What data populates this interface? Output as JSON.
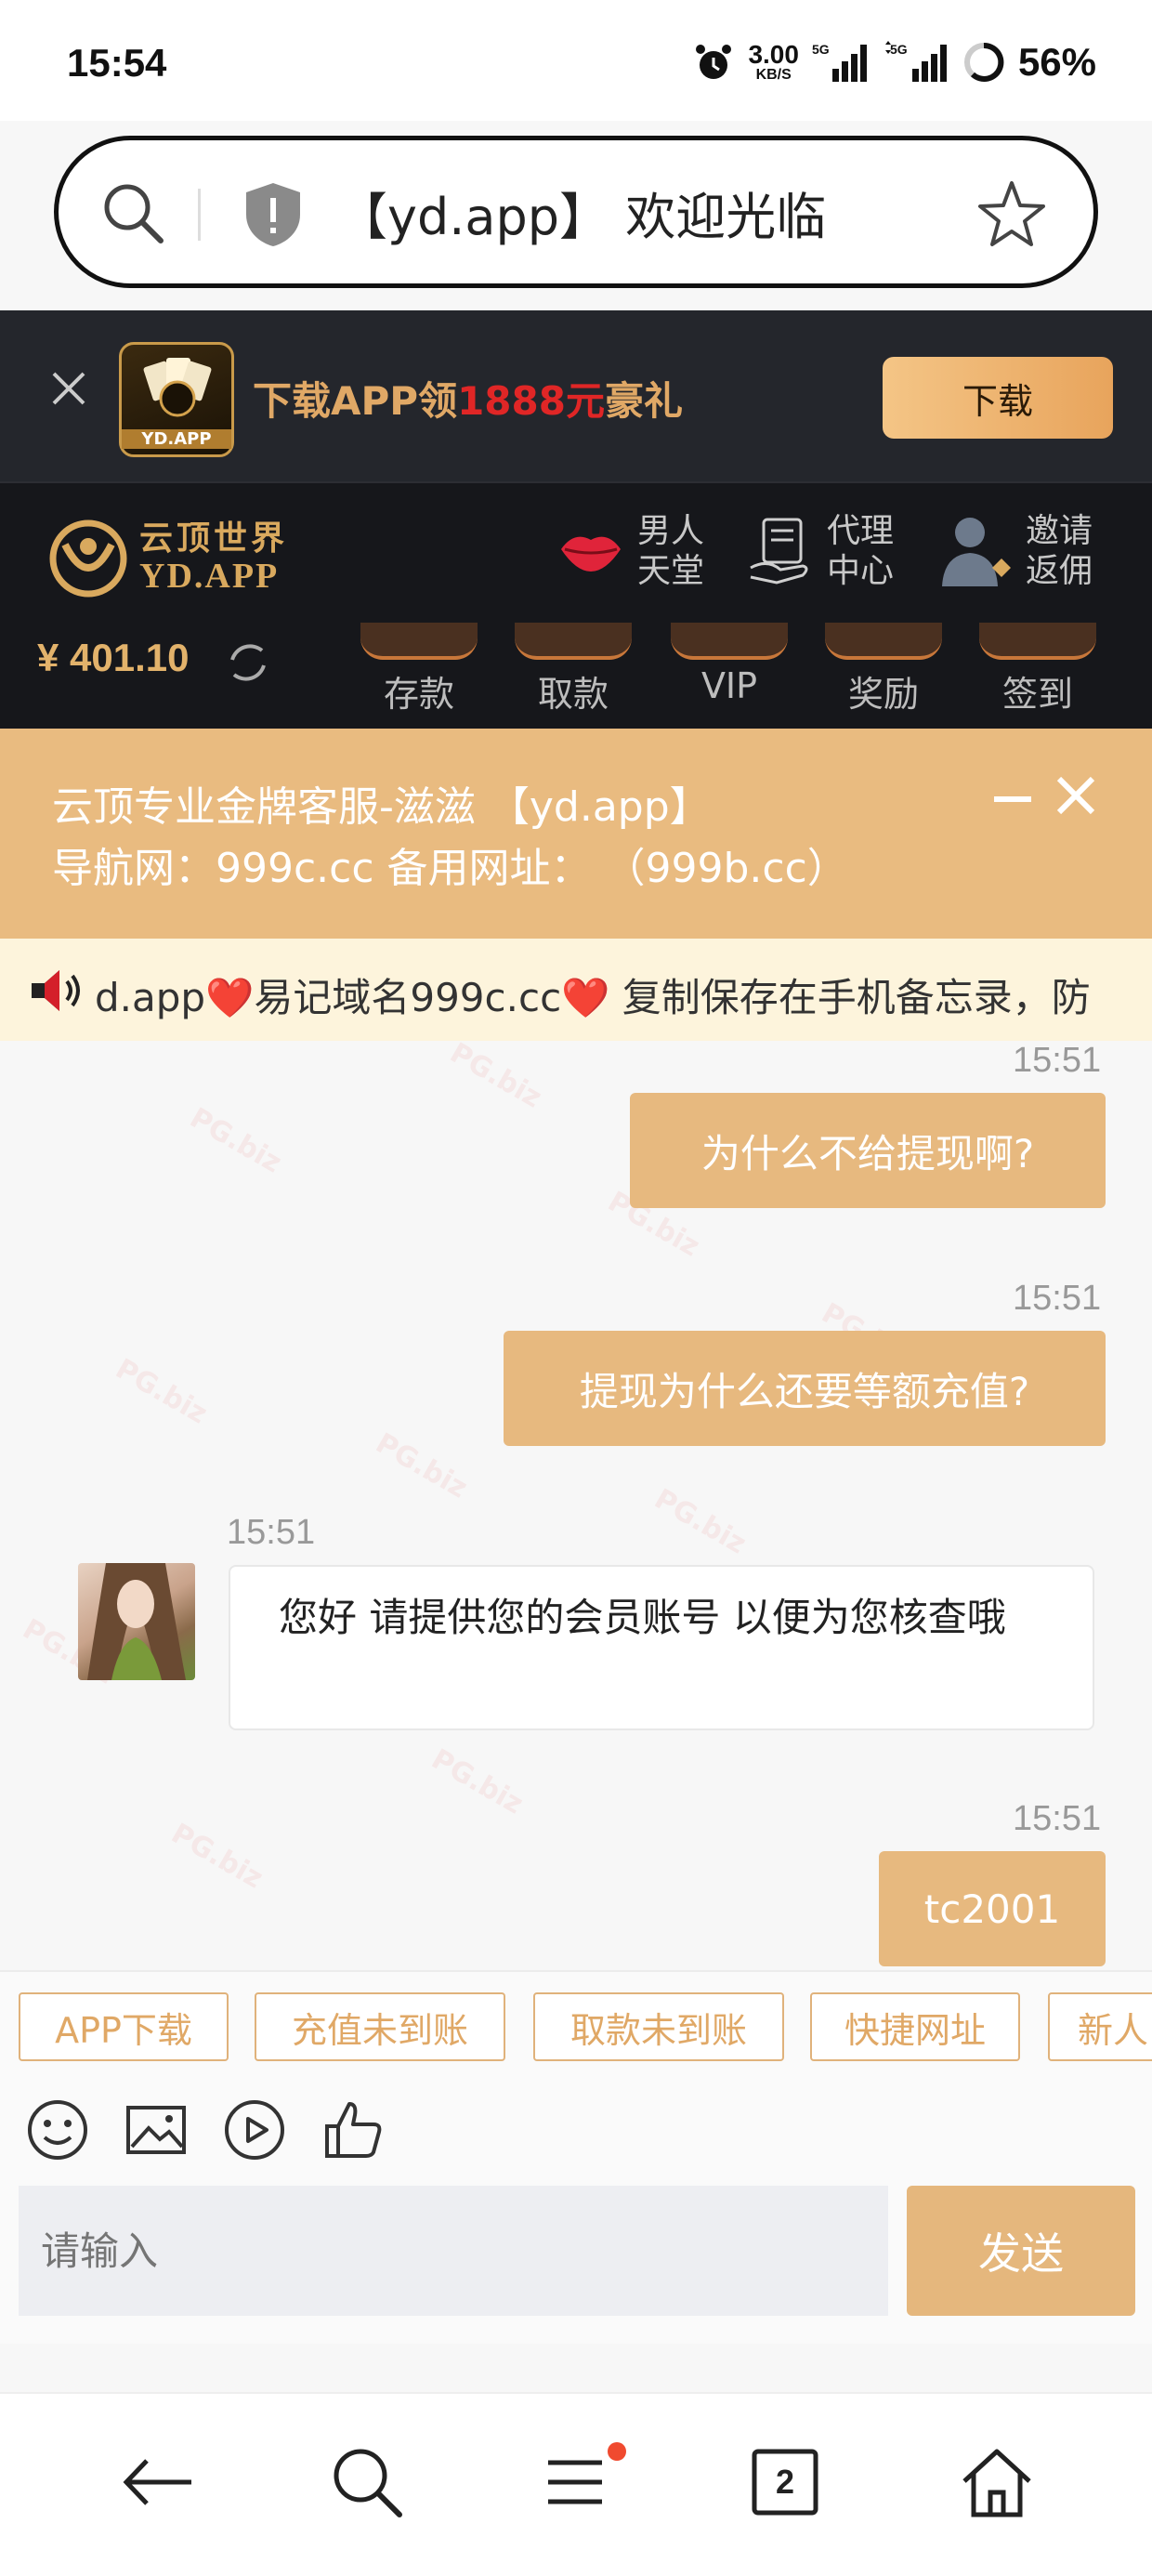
{
  "status_bar": {
    "time": "15:54",
    "speed_value": "3.00",
    "speed_unit": "KB/S",
    "network_1": "5G",
    "network_2": "5G",
    "battery": "56%"
  },
  "address_bar": {
    "title": "【yd.app】 欢迎光临"
  },
  "download_banner": {
    "logo_label": "YD.APP",
    "text_prefix": "下载APP领",
    "text_amount": "1888元",
    "text_suffix": "豪礼",
    "button_label": "下载"
  },
  "header": {
    "brand_cn": "云顶世界",
    "brand_en": "YD.APP",
    "nav": [
      {
        "line1": "男人",
        "line2": "天堂",
        "icon": "lips-icon"
      },
      {
        "line1": "代理",
        "line2": "中心",
        "icon": "agent-icon"
      },
      {
        "line1": "邀请",
        "line2": "返佣",
        "icon": "invite-icon"
      }
    ],
    "balance": "¥ 401.10",
    "quick_actions": [
      "存款",
      "取款",
      "VIP",
      "奖励",
      "签到"
    ]
  },
  "service_banner": {
    "line1": "云顶专业金牌客服-滋滋 【yd.app】",
    "line2": "导航网：999c.cc 备用网址：  （999b.cc）"
  },
  "marquee": {
    "text": "d.app❤️易记域名999c.cc❤️ 复制保存在手机备忘录，防"
  },
  "chat": {
    "messages": [
      {
        "time": "15:51",
        "from": "user",
        "text": "为什么不给提现啊?"
      },
      {
        "time": "15:51",
        "from": "user",
        "text": "提现为什么还要等额充值?"
      },
      {
        "time": "15:51",
        "from": "agent",
        "text": "您好 请提供您的会员账号 以便为您核查哦"
      },
      {
        "time": "15:51",
        "from": "user",
        "text": "tc2001"
      }
    ]
  },
  "quick_replies": [
    "APP下载",
    "充值未到账",
    "取款未到账",
    "快捷网址",
    "新人"
  ],
  "composer": {
    "placeholder": "请输入",
    "send_label": "发送"
  },
  "bottom_nav": {
    "tabs_count": "2"
  },
  "colors": {
    "accent": "#e7b97f",
    "dark_header": "#16171b",
    "banner_bg": "#24262c",
    "promo_red": "#e02626"
  }
}
